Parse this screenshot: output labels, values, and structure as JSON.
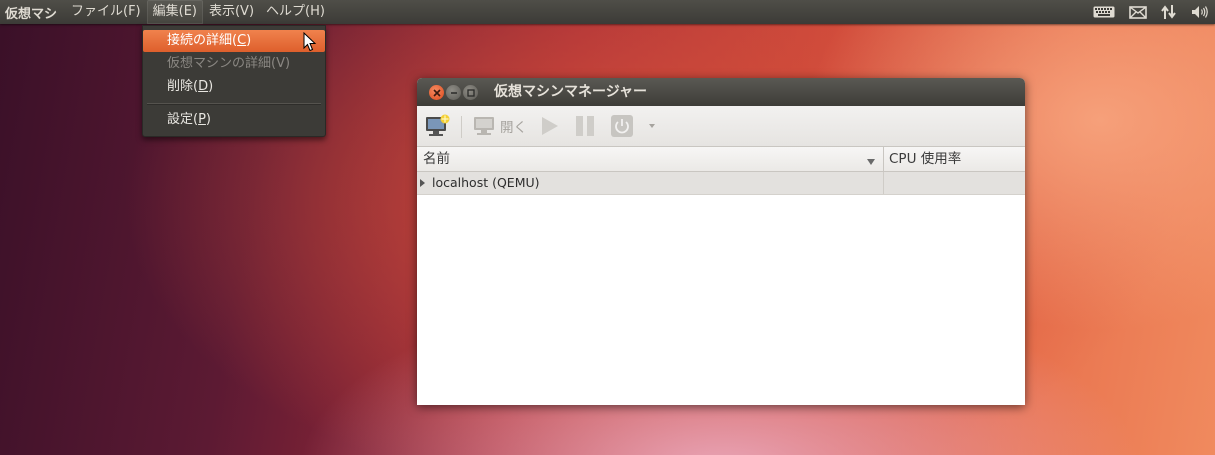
{
  "top_panel": {
    "app_name": "仮想マシ",
    "menus": [
      "ファイル(F)",
      "編集(E)",
      "表示(V)",
      "ヘルプ(H)"
    ],
    "indicators": [
      "keyboard-icon",
      "mail-icon",
      "network-icon",
      "volume-icon"
    ]
  },
  "edit_menu": {
    "items": [
      {
        "label": "接続の詳細(",
        "mnemonic": "C",
        "suffix": ")"
      },
      {
        "label": "仮想マシンの詳細(V)",
        "mnemonic": "",
        "suffix": ""
      },
      {
        "label": "削除(",
        "mnemonic": "D",
        "suffix": ")"
      },
      {
        "label": "設定(",
        "mnemonic": "P",
        "suffix": ")"
      }
    ]
  },
  "window": {
    "title": "仮想マシンマネージャー",
    "toolbar": {
      "open_label": "開く"
    },
    "columns": {
      "name": "名前",
      "cpu": "CPU 使用率"
    },
    "rows": [
      {
        "name": "localhost (QEMU)",
        "cpu": ""
      }
    ]
  },
  "colors": {
    "accent": "#e5672f",
    "panel": "#3c3b37",
    "close_button": "#df4a1b"
  }
}
